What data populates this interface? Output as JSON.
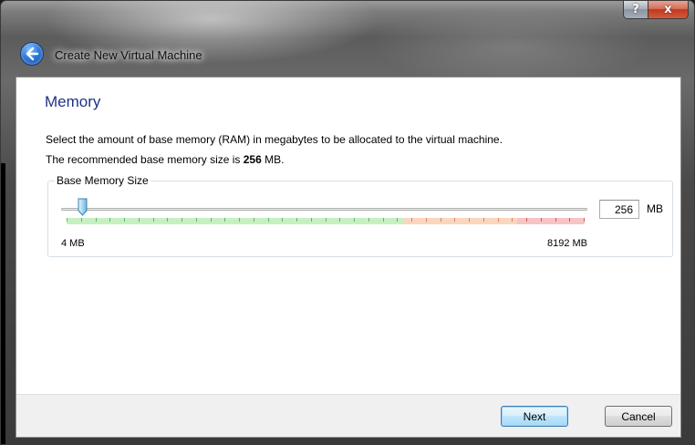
{
  "window": {
    "title": "Create New Virtual Machine",
    "help_glyph": "?",
    "close_glyph": "x"
  },
  "page": {
    "heading": "Memory",
    "description_line1": "Select the amount of base memory (RAM) in megabytes to be allocated to the virtual machine.",
    "description_line2_prefix": "The recommended base memory size is ",
    "description_line2_value": "256",
    "description_line2_suffix": " MB."
  },
  "memory_group": {
    "label": "Base Memory Size",
    "value": "256",
    "unit": "MB",
    "min_label": "4 MB",
    "max_label": "8192 MB",
    "min_mb": 4,
    "max_mb": 8192,
    "current_mb": 256,
    "safe_fraction": 0.65,
    "warning_fraction": 0.87,
    "colors": {
      "safe": "#c7f0c2",
      "warning": "#fbd5bf",
      "danger": "#f7c4c4",
      "safe_tick": "#5cb85c",
      "warning_tick": "#d8875a",
      "danger_tick": "#d9534f"
    }
  },
  "buttons": {
    "next": "Next",
    "cancel": "Cancel"
  },
  "icons": {
    "back": "back-arrow-icon",
    "slider_thumb": "slider-thumb-icon"
  }
}
